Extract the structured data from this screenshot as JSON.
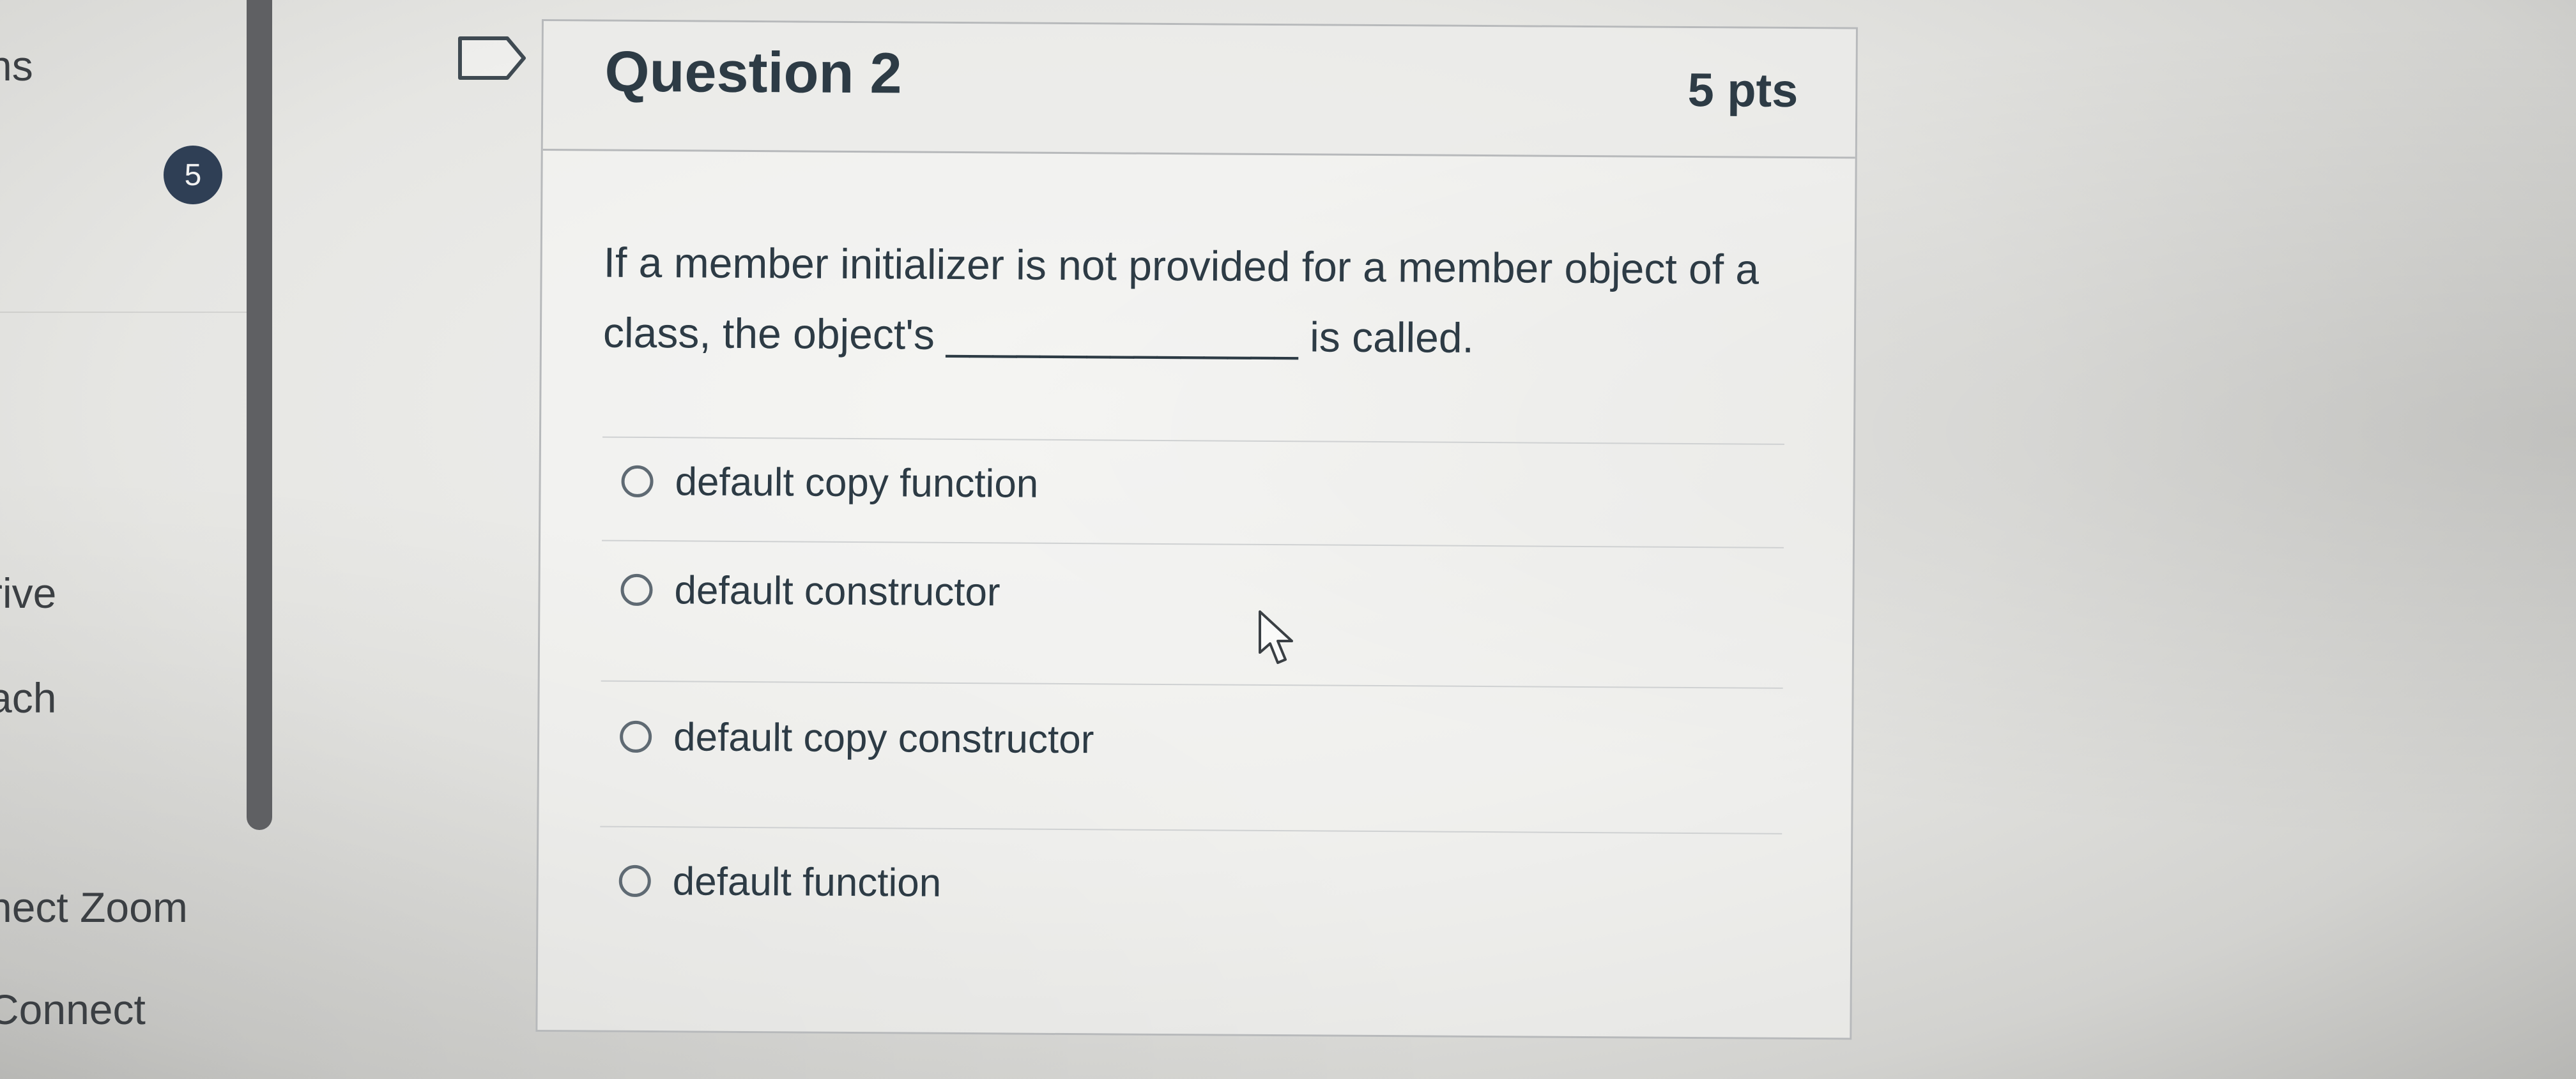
{
  "nav": {
    "items": [
      {
        "label": "ns"
      },
      {
        "label": "rive"
      },
      {
        "label": "ach"
      },
      {
        "label": "nect Zoom"
      },
      {
        "label": "Connect"
      }
    ],
    "badge": "5"
  },
  "question": {
    "title": "Question 2",
    "points": "5 pts",
    "text_before": "If a member initializer is not provided for a member object of a class, the object's",
    "blank": "_______________",
    "text_after": "is called.",
    "answers": [
      {
        "label": "default copy function"
      },
      {
        "label": "default constructor"
      },
      {
        "label": "default copy constructor"
      },
      {
        "label": "default function"
      }
    ]
  },
  "icons": {
    "flag": "bookmark-flag-icon",
    "radio": "radio-button-icon",
    "cursor": "mouse-pointer-icon"
  },
  "colors": {
    "text": "#2d3b45",
    "badge_bg": "#2f3f55",
    "scrollbar": "#5f6063",
    "border": "#b7b9bb"
  }
}
